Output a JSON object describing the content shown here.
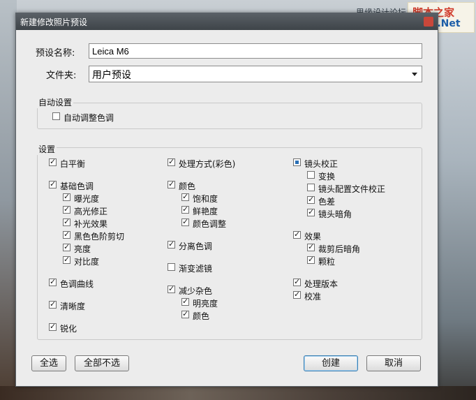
{
  "watermark": {
    "forum": "思缘设计论坛",
    "line1": "脚本之家",
    "line2": "JB51.Net"
  },
  "window": {
    "title": "新建修改照片预设"
  },
  "form": {
    "preset_name_label": "预设名称:",
    "preset_name_value": "Leica M6",
    "folder_label": "文件夹:",
    "folder_value": "用户预设"
  },
  "auto_group": {
    "title": "自动设置",
    "auto_tone": {
      "label": "自动调整色调",
      "checked": false
    }
  },
  "settings_group": {
    "title": "设置",
    "col1": {
      "white_balance": "白平衡",
      "basic_tone": "基础色调",
      "exposure": "曝光度",
      "highlights": "高光修正",
      "fill_light": "补光效果",
      "black_clipping": "黑色色阶剪切",
      "brightness": "亮度",
      "contrast": "对比度",
      "tone_curve": "色调曲线",
      "clarity": "清晰度",
      "sharpening": "锐化"
    },
    "col2": {
      "treatment": "处理方式(彩色)",
      "color": "颜色",
      "saturation": "饱和度",
      "vibrance": "鲜艳度",
      "color_adjust": "颜色调整",
      "split_toning": "分离色调",
      "graduated_filter": "渐变滤镜",
      "noise_reduction": "减少杂色",
      "luminance": "明亮度",
      "nr_color": "颜色"
    },
    "col3": {
      "lens_corrections": "镜头校正",
      "transform": "变换",
      "lens_profile": "镜头配置文件校正",
      "chromatic_aberration": "色差",
      "vignetting": "镜头暗角",
      "effects": "效果",
      "post_crop_vignette": "裁剪后暗角",
      "grain": "颗粒",
      "process_version": "处理版本",
      "calibration": "校准"
    }
  },
  "buttons": {
    "select_all": "全选",
    "select_none": "全部不选",
    "create": "创建",
    "cancel": "取消"
  },
  "colors": {
    "accent": "#2a6fb5",
    "titlebar": "#3e4449",
    "dialog_bg": "#ececec"
  },
  "icons": {
    "close": "close-icon",
    "dropdown": "chevron-down-icon",
    "checkbox": "checkbox-icon"
  }
}
